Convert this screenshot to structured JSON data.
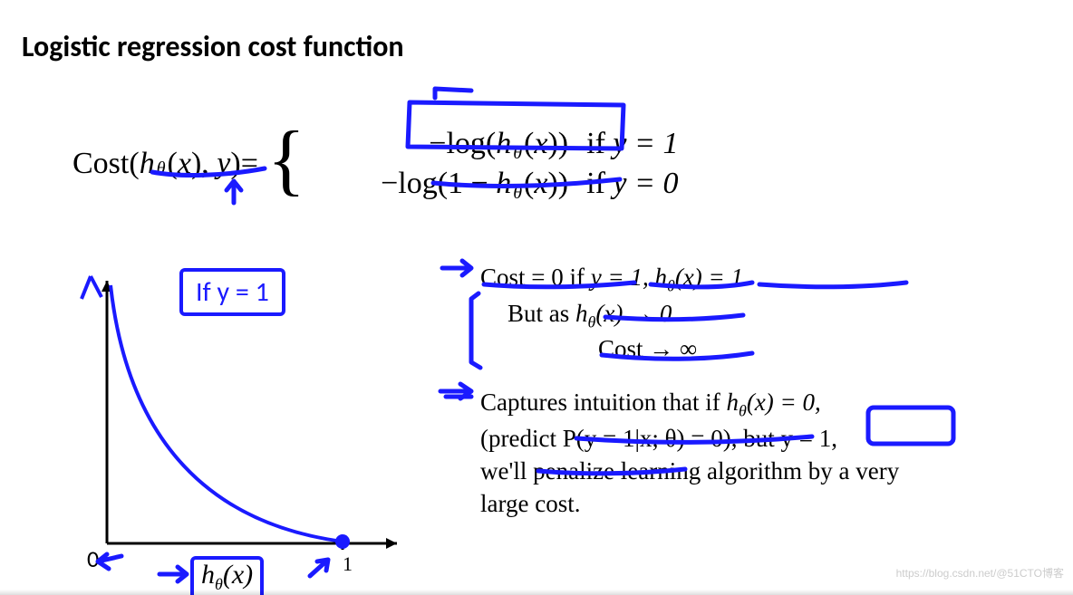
{
  "title": "Logistic regression cost function",
  "formula": {
    "lhs_cost": "Cost",
    "lhs_h": "h",
    "lhs_sub": "θ",
    "lhs_x": "x",
    "lhs_y": "y",
    "eq": " = ",
    "case1_expr_a": "−log(",
    "case1_expr_b": "h",
    "case1_expr_sub": "θ",
    "case1_expr_c": "x",
    "case1_expr_d": "))",
    "case1_cond_if": "if ",
    "case1_cond": "y = 1",
    "case2_expr_a": "−log(1 − ",
    "case2_expr_b": "h",
    "case2_expr_sub": "θ",
    "case2_expr_c": "x",
    "case2_expr_d": "))",
    "case2_cond_if": "if ",
    "case2_cond": "y = 0"
  },
  "ify_box": "If y = 1",
  "graph": {
    "origin_label": "0",
    "max_label": "1",
    "x_axis_label_h": "h",
    "x_axis_label_sub": "θ",
    "x_axis_label_x": "x"
  },
  "bullets": {
    "b1_line1_a": "Cost = 0 if ",
    "b1_line1_b": "y = 1, ",
    "b1_line1_c": "h",
    "b1_line1_sub": "θ",
    "b1_line1_d": "(x) = 1",
    "b1_line2_a": "But as   ",
    "b1_line2_b": "h",
    "b1_line2_sub": "θ",
    "b1_line2_c": "(x) → 0",
    "b1_line3_a": "Cost → ∞",
    "b2_line1_a": "Captures intuition that if ",
    "b2_line1_b": "h",
    "b2_line1_sub": "θ",
    "b2_line1_c": "(x) = 0,",
    "b2_line2": "(predict  P(y = 1|x; θ) = 0), but y = 1,",
    "b2_line3": "we'll penalize learning algorithm by a very",
    "b2_line4": "large cost."
  },
  "watermark": "https://blog.csdn.net/@51CTO博客",
  "colors": {
    "ink": "#1a1aff"
  }
}
